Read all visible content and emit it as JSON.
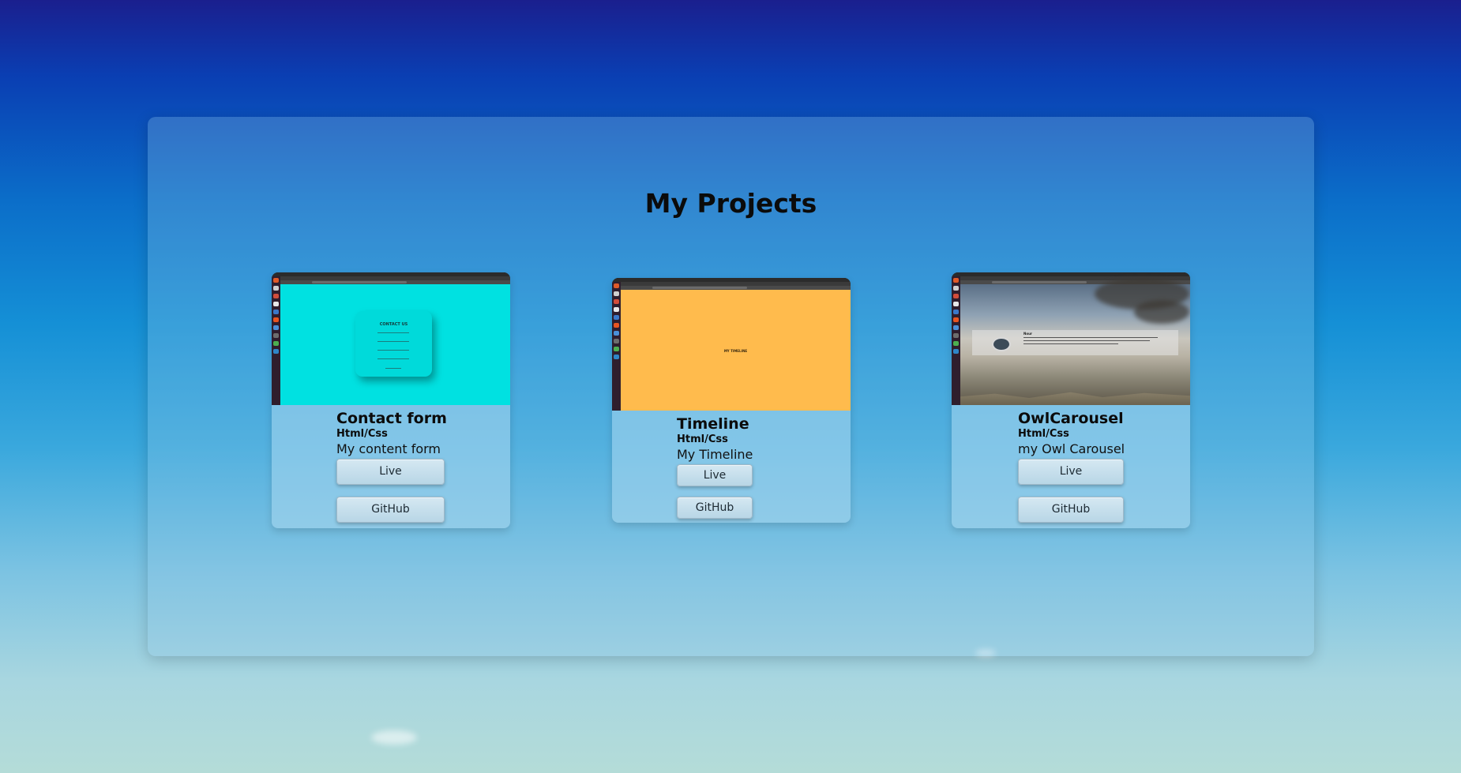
{
  "page": {
    "title": "My Projects"
  },
  "projects": [
    {
      "title": "Contact form",
      "tech": "Html/Css",
      "description": "My content form",
      "live_label": "Live",
      "github_label": "GitHub",
      "preview": {
        "background": "#00e1e1",
        "heading": "CONTACT US"
      }
    },
    {
      "title": "Timeline",
      "tech": "Html/Css",
      "description": "My Timeline",
      "live_label": "Live",
      "github_label": "GitHub",
      "preview": {
        "background": "#ffbb4d",
        "heading": "MY TIMELINE"
      }
    },
    {
      "title": "OwlCarousel",
      "tech": "Html/Css",
      "description": "my Owl Carousel",
      "live_label": "Live",
      "github_label": "GitHub",
      "preview": {
        "background": "sky",
        "heading": "Nour"
      }
    }
  ]
}
